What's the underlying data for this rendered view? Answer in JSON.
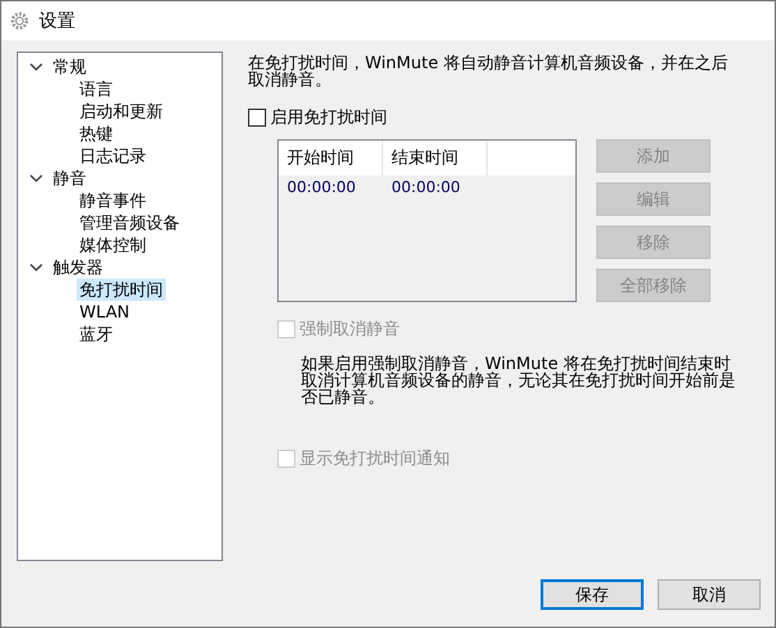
{
  "window": {
    "title": "设置"
  },
  "tree": [
    {
      "label": "常规",
      "expanded": true,
      "selected": false,
      "children": [
        {
          "label": "语言",
          "selected": false
        },
        {
          "label": "启动和更新",
          "selected": false
        },
        {
          "label": "热键",
          "selected": false
        },
        {
          "label": "日志记录",
          "selected": false
        }
      ]
    },
    {
      "label": "静音",
      "expanded": true,
      "selected": false,
      "children": [
        {
          "label": "静音事件",
          "selected": false
        },
        {
          "label": "管理音频设备",
          "selected": false
        },
        {
          "label": "媒体控制",
          "selected": false
        }
      ]
    },
    {
      "label": "触发器",
      "expanded": true,
      "selected": false,
      "children": [
        {
          "label": "免打扰时间",
          "selected": true
        },
        {
          "label": "WLAN",
          "selected": false
        },
        {
          "label": "蓝牙",
          "selected": false
        }
      ]
    }
  ],
  "description": "在免打扰时间，WinMute 将自动静音计算机音频设备，并在之后取消静音。",
  "enable_checkbox": {
    "label": "启用免打扰时间",
    "checked": false,
    "disabled": false
  },
  "table": {
    "columns": [
      "开始时间",
      "结束时间"
    ],
    "rows": [
      [
        "00:00:00",
        "00:00:00"
      ]
    ]
  },
  "side_buttons": [
    {
      "label": "添加",
      "disabled": true
    },
    {
      "label": "编辑",
      "disabled": true
    },
    {
      "label": "移除",
      "disabled": true
    },
    {
      "label": "全部移除",
      "disabled": true
    }
  ],
  "force_unmute": {
    "label": "强制取消静音",
    "checked": false,
    "disabled": true
  },
  "force_note": "如果启用强制取消静音，WinMute 将在免打扰时间结束时取消计算机音频设备的静音，无论其在免打扰时间开始前是否已静音。",
  "notify": {
    "label": "显示免打扰时间通知",
    "checked": false,
    "disabled": true
  },
  "footer_buttons": [
    {
      "label": "保存",
      "default": true
    },
    {
      "label": "取消",
      "default": false
    }
  ]
}
